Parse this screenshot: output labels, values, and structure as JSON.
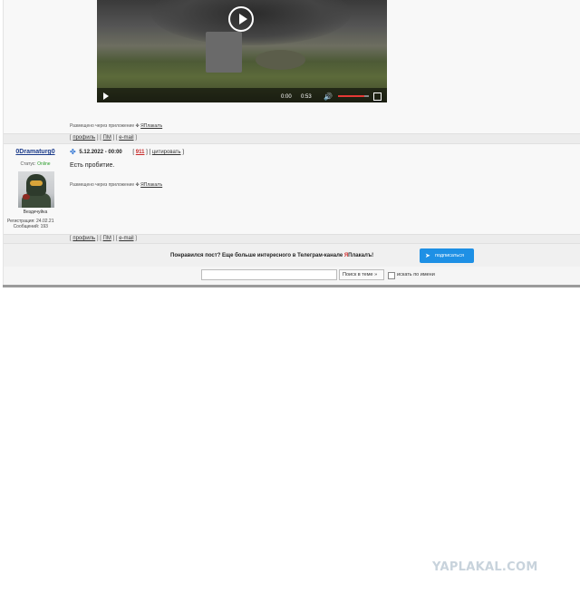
{
  "video": {
    "time_current": "0:00",
    "time_remaining": "0:53",
    "volume_level": 0.85
  },
  "post1": {
    "placed_prefix": "Размещено через приложение",
    "placed_app": "ЯПлакалъ",
    "links": {
      "profile": "профиль",
      "pm": "ПМ",
      "email": "e-mail"
    }
  },
  "post2": {
    "author": "0Dramaturg0",
    "status_label": "Статус:",
    "status_value": "Online",
    "rank": "Вездечуйка",
    "reg_line": "Регистрация: 24.02.21",
    "posts_line": "Сообщений: 193",
    "date": "5.12.2022 - 00:00",
    "post_number": "911",
    "quote_label": "цитировать",
    "text": "Есть пробитие.",
    "placed_prefix": "Размещено через приложение",
    "placed_app": "ЯПлакалъ",
    "links": {
      "profile": "профиль",
      "pm": "ПМ",
      "email": "e-mail"
    }
  },
  "telegram": {
    "text_before": "Понравился пост? Еще больше интересного в Телеграм-канале ",
    "brand_red": "Я",
    "brand_rest": "Плакалъ!",
    "button_label": "подписаться",
    "accent": "#1e90e5"
  },
  "search": {
    "input_value": "",
    "button_label": "Поиск в теме »",
    "checkbox_label": "искать по имени"
  },
  "watermark": "YAPLAKAL.COM"
}
